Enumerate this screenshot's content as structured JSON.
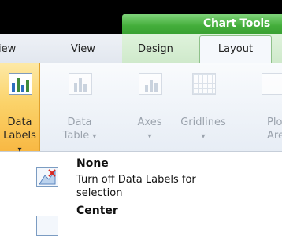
{
  "title_strip": {
    "context_label": "Chart Tools"
  },
  "tabs": [
    {
      "label": "iew"
    },
    {
      "label": "View"
    },
    {
      "label": "Design"
    },
    {
      "label": "Layout",
      "selected": true
    }
  ],
  "ribbon": {
    "data_labels": {
      "line1": "Data",
      "line2": "Labels",
      "dropdown": "▾"
    },
    "data_table": {
      "line1": "Data",
      "line2": "Table",
      "dropdown": "▾"
    },
    "axes": {
      "label": "Axes",
      "dropdown": "▾"
    },
    "gridlines": {
      "label": "Gridlines",
      "dropdown": "▾"
    },
    "plot_area": {
      "line1": "Plo",
      "line2": "Are"
    }
  },
  "menu": {
    "items": [
      {
        "title": "None",
        "desc": "Turn off Data Labels for selection",
        "icon": "no-data-labels-icon"
      },
      {
        "title": "Center",
        "icon": "center-data-labels-icon"
      }
    ]
  },
  "colors": {
    "selected_button": "#fbd36a",
    "chart_tools_green": "#43ad3a"
  }
}
